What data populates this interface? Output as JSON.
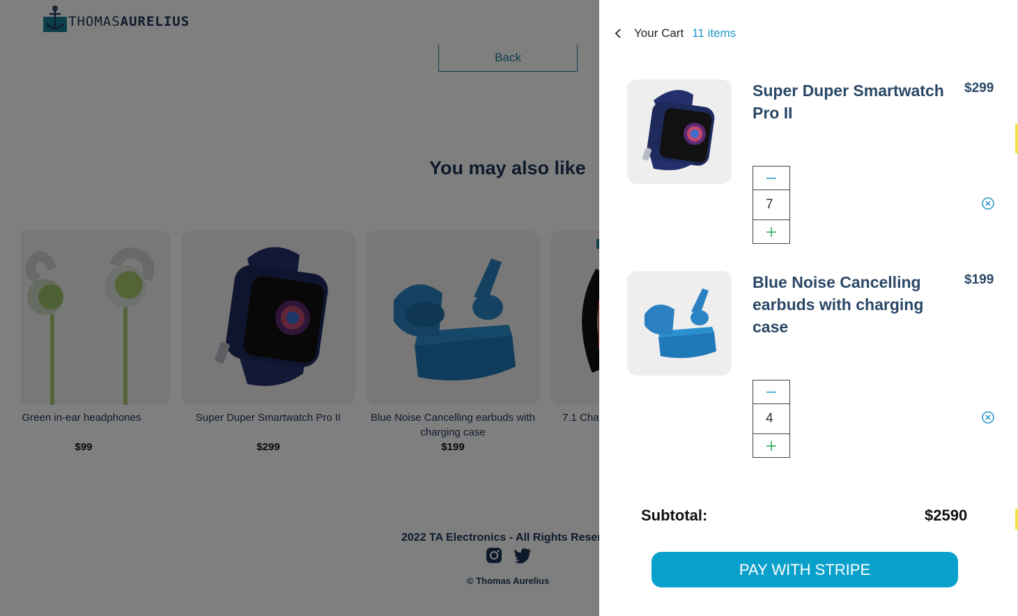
{
  "brand": {
    "name_thin": "THOMAS",
    "name_bold": "AURELIUS"
  },
  "store": {
    "back_label": "Back",
    "section_title": "You may also like",
    "recommendations": [
      {
        "name": "Green in-ear headphones",
        "price": "$99"
      },
      {
        "name": "Super Duper Smartwatch Pro II",
        "price": "$299"
      },
      {
        "name": "Blue Noise Cancelling earbuds with charging case",
        "price": "$199"
      },
      {
        "name": "7.1 Cha",
        "price": ""
      }
    ],
    "footer": "2022 TA Electronics - All Rights Reserv",
    "copyright": "© Thomas Aurelius",
    "social_icons": [
      "instagram-icon",
      "twitter-icon"
    ]
  },
  "cart": {
    "title": "Your Cart",
    "count": "11 items",
    "items": [
      {
        "name": "Super Duper Smartwatch Pro II",
        "price": "$299",
        "quantity": "7"
      },
      {
        "name": "Blue Noise Cancelling earbuds with charging case",
        "price": "$199",
        "quantity": "4"
      }
    ],
    "subtotal_label": "Subtotal:",
    "subtotal_value": "$2590",
    "pay_label": "PAY WITH STRIPE"
  },
  "colors": {
    "accent": "#0aa0cc",
    "brand_navy": "#1c3557",
    "link": "#1b95c7",
    "plus": "#25a84f"
  }
}
